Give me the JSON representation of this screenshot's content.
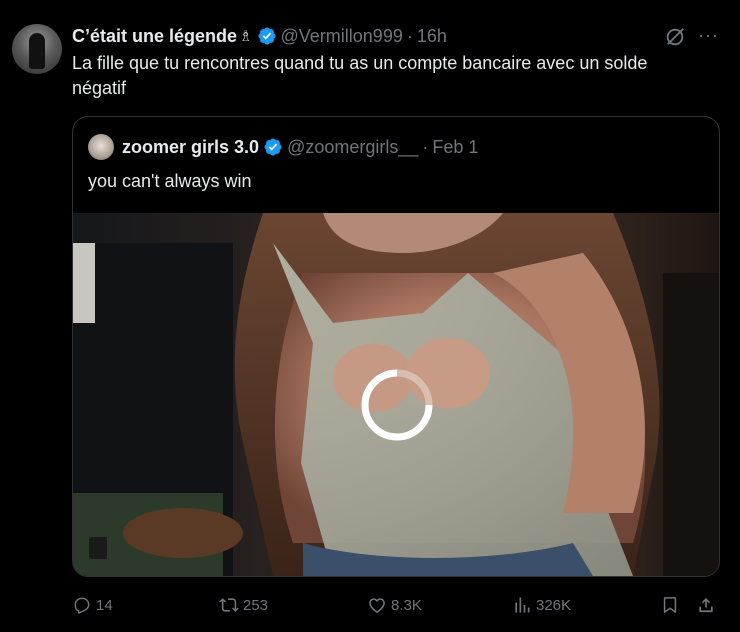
{
  "tweet": {
    "author_name": "C’était une légende",
    "name_emoji": "♗",
    "handle": "@Vermillon999",
    "separator": "·",
    "time": "16h",
    "text": "La fille que tu rencontres quand tu as un compte bancaire avec un solde négatif",
    "more": "···"
  },
  "quoted": {
    "author_name": "zoomer girls 3.0",
    "handle": "@zoomergirls__",
    "separator": "·",
    "date": "Feb 1",
    "text": "you can't always win"
  },
  "actions": {
    "replies": "14",
    "reposts": "253",
    "likes": "8.3K",
    "views": "326K"
  },
  "colors": {
    "background": "#000000",
    "text_primary": "#e7e9ea",
    "text_secondary": "#71767b",
    "verified": "#1d9bf0",
    "border": "#2f3336"
  }
}
